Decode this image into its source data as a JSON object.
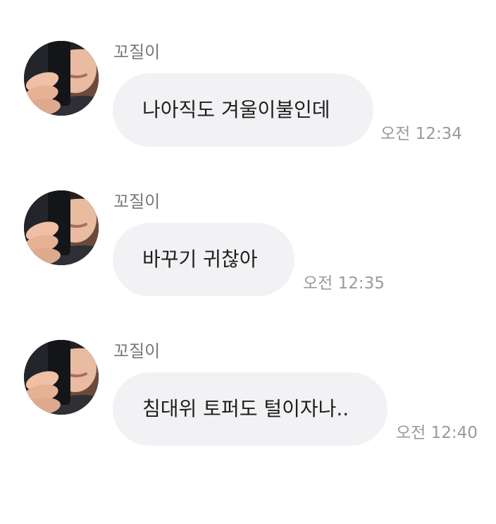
{
  "messages": [
    {
      "sender": "꼬질이",
      "avatar_icon": "user-avatar-photo",
      "text": "나아직도 겨울이불인데",
      "time": "오전 12:34"
    },
    {
      "sender": "꼬질이",
      "avatar_icon": "user-avatar-photo",
      "text": "바꾸기 귀찮아",
      "time": "오전 12:35"
    },
    {
      "sender": "꼬질이",
      "avatar_icon": "user-avatar-photo",
      "text": "침대위 토퍼도 털이자나..",
      "time": "오전 12:40"
    }
  ],
  "colors": {
    "bubble": "#f2f2f5",
    "message_text": "#1e1e1e",
    "sender_name": "#777777",
    "timestamp": "#9a9a9a",
    "background": "#ffffff"
  }
}
